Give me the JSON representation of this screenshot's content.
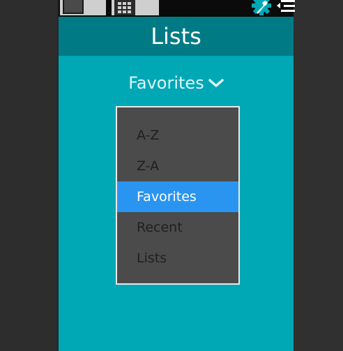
{
  "title": "Lists",
  "sort_dropdown": {
    "selected": "Favorites",
    "options": [
      "A-Z",
      "Z-A",
      "Favorites",
      "Recent",
      "Lists"
    ],
    "selected_color": "#2a95f0"
  },
  "colors": {
    "accent": "#00a8b5",
    "title_bar": "#007b86",
    "menu_bg": "#4b4b4b"
  },
  "icons": [
    "gear-icon",
    "wrench-icon",
    "menu-lines-icon",
    "grid-icon",
    "chevron-down-icon"
  ]
}
